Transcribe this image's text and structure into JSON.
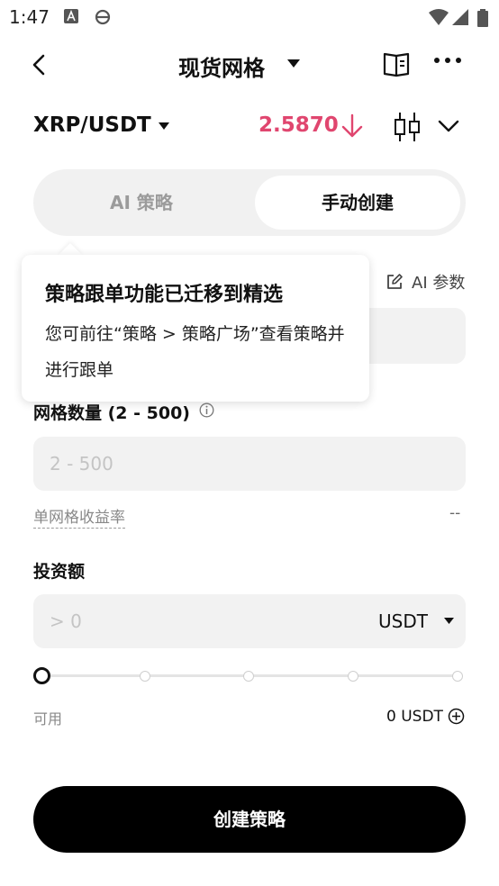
{
  "status_bar": {
    "time": "1:47"
  },
  "nav": {
    "title": "现货网格"
  },
  "pair": {
    "symbol": "XRP/USDT",
    "price": "2.5870",
    "price_color": "#e0466f"
  },
  "tabs": {
    "ai_label": "AI 策略",
    "manual_label": "手动创建",
    "active": "manual"
  },
  "ai_params_label": "AI 参数",
  "tooltip": {
    "title": "策略跟单功能已迁移到精选",
    "body": "您可前往“策略 > 策略广场”查看策略并进行跟单"
  },
  "grid": {
    "label": "网格数量 (2 - 500)",
    "placeholder": "2 - 500",
    "yield_label": "单网格收益率",
    "yield_value": "--"
  },
  "investment": {
    "label": "投资额",
    "placeholder": "> 0",
    "unit": "USDT",
    "slider_fraction": 0
  },
  "available": {
    "label": "可用",
    "value": "0 USDT"
  },
  "create_button": "创建策略"
}
